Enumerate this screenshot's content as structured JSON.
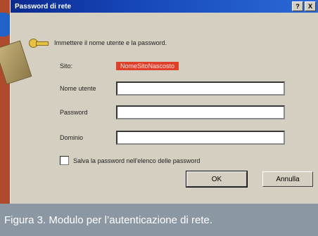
{
  "window": {
    "title": "Password di rete",
    "help_label": "?",
    "close_label": "X"
  },
  "prompt": {
    "text": "Immettere il nome utente e la password."
  },
  "fields": {
    "site_label": "Sito:",
    "site_value": "NomeSitoNascosto",
    "username_label": "Nome utente",
    "username_value": "",
    "password_label": "Password",
    "password_value": "",
    "domain_label": "Dominio",
    "domain_value": ""
  },
  "checkbox": {
    "label": "Salva la password nell'elenco delle password",
    "checked": false
  },
  "buttons": {
    "ok_label": "OK",
    "cancel_label": "Annulla"
  },
  "caption": {
    "text": "Figura 3. Modulo per l’autenticazione di rete."
  },
  "colors": {
    "title_bar": "#1647b9",
    "dialog_bg": "#d4cfc0",
    "site_highlight": "#e0402a",
    "caption_bg": "#8c97a4",
    "page_bg": "#b04a2c"
  }
}
